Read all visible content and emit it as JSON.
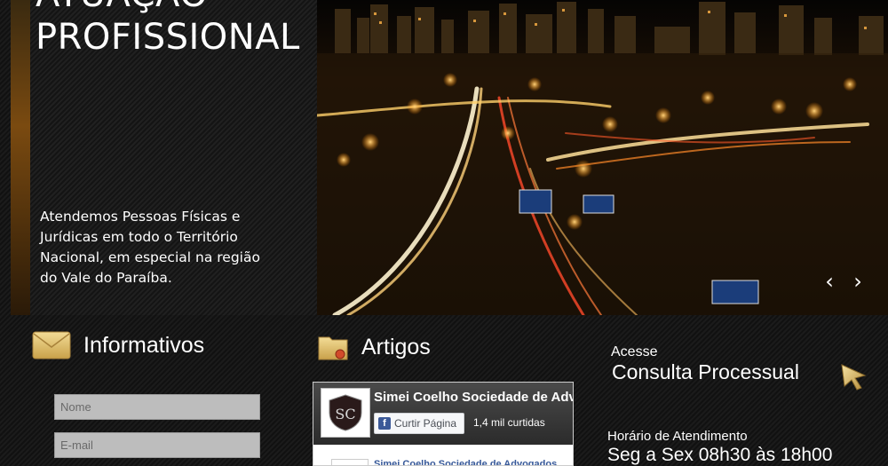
{
  "hero": {
    "title": "ATUAÇÃO\nPROFISSIONAL",
    "text": "Atendemos Pessoas Físicas e Jurídicas em todo o Território Nacional, em especial na região do Vale do Paraíba.",
    "prev_icon": "chevron-left-icon",
    "next_icon": "chevron-right-icon",
    "prev_glyph": "‹",
    "next_glyph": "›"
  },
  "informativos": {
    "title": "Informativos",
    "icon": "envelope-icon",
    "name_placeholder": "Nome",
    "email_placeholder": "E-mail"
  },
  "artigos": {
    "title": "Artigos",
    "icon": "folder-icon",
    "facebook": {
      "page_name": "Simei Coelho Sociedade de Advogados",
      "like_button": "Curtir Página",
      "like_count": "1,4 mil curtidas",
      "post_text": "Simei Coelho Sociedade de Advogados"
    }
  },
  "consulta": {
    "access_label": "Acesse",
    "link_label": "Consulta Processual",
    "icon": "cursor-arrow-icon"
  },
  "atendimento": {
    "label": "Horário de Atendimento",
    "value": "Seg a Sex 08h30 às 18h00"
  },
  "colors": {
    "accent_gold": "#e2c36b",
    "facebook_blue": "#3b5998",
    "background": "#161616"
  }
}
